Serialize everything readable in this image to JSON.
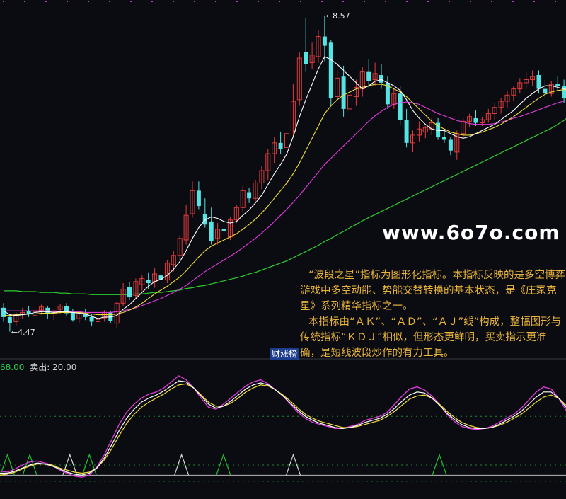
{
  "colors": {
    "background": "#0b0b12",
    "up_candle": "#e03c3c",
    "down_candle": "#54e4e4",
    "ma_white": "#ffffff",
    "ma_yellow": "#f2e03a",
    "ma_magenta": "#e23cdc",
    "ma_green": "#2ecf2e",
    "dotted_grid": "#1f8a2e",
    "buy_triangle": "#22c32e",
    "sell_triangle": "#d9d9d9",
    "text_orange": "#e8b43a"
  },
  "watermark": "www.6o7o.com",
  "description": {
    "line1": "“波段之星”指标为图形化指标。本指标反映的是多空博弈游戏中多空动能、势能交替转换的基本状态，是《庄家克星》系列精华指标之一。",
    "line2": "本指标由“ＡＫ”、“ＡＤ”、“ＡＪ”线”构成，整幅图形与传统指标“ＫＤＪ”相似，但形态更鲜明，买卖指示更准确，是短线波段炒作的有力工具。"
  },
  "tag": "财涨榜",
  "subchart": {
    "buy_text": "68.00",
    "sell_text": "卖出: 20.00"
  },
  "chart_data": [
    {
      "type": "candlestick",
      "annotations": [
        {
          "text": "8.57",
          "kind": "high"
        },
        {
          "text": "4.47",
          "kind": "low"
        }
      ],
      "ylim": [
        4.2,
        8.7
      ],
      "candles": [
        {
          "o": 4.78,
          "h": 4.84,
          "l": 4.6,
          "c": 4.66
        },
        {
          "o": 4.66,
          "h": 4.7,
          "l": 4.47,
          "c": 4.58
        },
        {
          "o": 4.6,
          "h": 4.72,
          "l": 4.55,
          "c": 4.69
        },
        {
          "o": 4.7,
          "h": 4.78,
          "l": 4.64,
          "c": 4.72
        },
        {
          "o": 4.74,
          "h": 4.8,
          "l": 4.66,
          "c": 4.7
        },
        {
          "o": 4.68,
          "h": 4.75,
          "l": 4.6,
          "c": 4.73
        },
        {
          "o": 4.75,
          "h": 4.82,
          "l": 4.69,
          "c": 4.79
        },
        {
          "o": 4.78,
          "h": 4.8,
          "l": 4.64,
          "c": 4.7
        },
        {
          "o": 4.7,
          "h": 4.76,
          "l": 4.62,
          "c": 4.74
        },
        {
          "o": 4.76,
          "h": 4.83,
          "l": 4.7,
          "c": 4.8
        },
        {
          "o": 4.8,
          "h": 4.84,
          "l": 4.68,
          "c": 4.71
        },
        {
          "o": 4.72,
          "h": 4.76,
          "l": 4.6,
          "c": 4.62
        },
        {
          "o": 4.64,
          "h": 4.72,
          "l": 4.58,
          "c": 4.7
        },
        {
          "o": 4.7,
          "h": 4.76,
          "l": 4.62,
          "c": 4.66
        },
        {
          "o": 4.66,
          "h": 4.7,
          "l": 4.55,
          "c": 4.6
        },
        {
          "o": 4.6,
          "h": 4.66,
          "l": 4.52,
          "c": 4.63
        },
        {
          "o": 4.65,
          "h": 4.75,
          "l": 4.6,
          "c": 4.72
        },
        {
          "o": 4.72,
          "h": 4.74,
          "l": 4.58,
          "c": 4.61
        },
        {
          "o": 4.58,
          "h": 4.86,
          "l": 4.52,
          "c": 4.84
        },
        {
          "o": 4.84,
          "h": 5.1,
          "l": 4.8,
          "c": 5.02
        },
        {
          "o": 5.05,
          "h": 5.12,
          "l": 4.88,
          "c": 4.92
        },
        {
          "o": 4.94,
          "h": 5.16,
          "l": 4.9,
          "c": 5.12
        },
        {
          "o": 5.08,
          "h": 5.2,
          "l": 5.0,
          "c": 5.16
        },
        {
          "o": 5.14,
          "h": 5.24,
          "l": 5.02,
          "c": 5.1
        },
        {
          "o": 5.12,
          "h": 5.3,
          "l": 5.04,
          "c": 5.22
        },
        {
          "o": 5.2,
          "h": 5.26,
          "l": 5.08,
          "c": 5.14
        },
        {
          "o": 5.14,
          "h": 5.4,
          "l": 5.1,
          "c": 5.36
        },
        {
          "o": 5.34,
          "h": 5.52,
          "l": 5.25,
          "c": 5.46
        },
        {
          "o": 5.46,
          "h": 5.72,
          "l": 5.4,
          "c": 5.68
        },
        {
          "o": 5.66,
          "h": 6.12,
          "l": 5.6,
          "c": 5.98
        },
        {
          "o": 6.0,
          "h": 6.42,
          "l": 5.95,
          "c": 6.3
        },
        {
          "o": 6.3,
          "h": 6.42,
          "l": 6.06,
          "c": 6.1
        },
        {
          "o": 6.0,
          "h": 6.2,
          "l": 5.82,
          "c": 5.86
        },
        {
          "o": 5.9,
          "h": 6.08,
          "l": 5.6,
          "c": 5.65
        },
        {
          "o": 5.68,
          "h": 5.88,
          "l": 5.6,
          "c": 5.8
        },
        {
          "o": 5.8,
          "h": 5.86,
          "l": 5.7,
          "c": 5.78
        },
        {
          "o": 5.7,
          "h": 5.96,
          "l": 5.66,
          "c": 5.92
        },
        {
          "o": 5.92,
          "h": 6.12,
          "l": 5.88,
          "c": 6.08
        },
        {
          "o": 6.08,
          "h": 6.36,
          "l": 6.02,
          "c": 6.3
        },
        {
          "o": 6.28,
          "h": 6.34,
          "l": 6.14,
          "c": 6.2
        },
        {
          "o": 6.2,
          "h": 6.44,
          "l": 6.16,
          "c": 6.4
        },
        {
          "o": 6.4,
          "h": 6.62,
          "l": 6.32,
          "c": 6.56
        },
        {
          "o": 6.56,
          "h": 6.84,
          "l": 6.44,
          "c": 6.78
        },
        {
          "o": 6.78,
          "h": 7.0,
          "l": 6.66,
          "c": 6.92
        },
        {
          "o": 6.92,
          "h": 7.06,
          "l": 6.78,
          "c": 6.84
        },
        {
          "o": 6.86,
          "h": 7.1,
          "l": 6.82,
          "c": 7.04
        },
        {
          "o": 7.06,
          "h": 7.68,
          "l": 7.0,
          "c": 7.46
        },
        {
          "o": 7.48,
          "h": 8.1,
          "l": 7.4,
          "c": 8.02
        },
        {
          "o": 8.1,
          "h": 8.54,
          "l": 7.84,
          "c": 7.94
        },
        {
          "o": 7.96,
          "h": 8.22,
          "l": 7.88,
          "c": 8.06
        },
        {
          "o": 8.04,
          "h": 8.38,
          "l": 7.96,
          "c": 8.3
        },
        {
          "o": 8.3,
          "h": 8.57,
          "l": 7.98,
          "c": 8.18
        },
        {
          "o": 8.22,
          "h": 8.26,
          "l": 7.4,
          "c": 7.5
        },
        {
          "o": 7.52,
          "h": 7.86,
          "l": 7.48,
          "c": 7.76
        },
        {
          "o": 7.78,
          "h": 7.92,
          "l": 7.26,
          "c": 7.36
        },
        {
          "o": 7.36,
          "h": 7.62,
          "l": 7.24,
          "c": 7.54
        },
        {
          "o": 7.52,
          "h": 7.74,
          "l": 7.4,
          "c": 7.64
        },
        {
          "o": 7.62,
          "h": 7.9,
          "l": 7.52,
          "c": 7.84
        },
        {
          "o": 7.84,
          "h": 8.0,
          "l": 7.64,
          "c": 7.72
        },
        {
          "o": 7.74,
          "h": 7.96,
          "l": 7.66,
          "c": 7.82
        },
        {
          "o": 7.8,
          "h": 7.94,
          "l": 7.62,
          "c": 7.7
        },
        {
          "o": 7.7,
          "h": 7.78,
          "l": 7.36,
          "c": 7.42
        },
        {
          "o": 7.42,
          "h": 7.62,
          "l": 7.36,
          "c": 7.56
        },
        {
          "o": 7.56,
          "h": 7.66,
          "l": 7.16,
          "c": 7.22
        },
        {
          "o": 7.22,
          "h": 7.36,
          "l": 6.86,
          "c": 6.92
        },
        {
          "o": 6.92,
          "h": 7.08,
          "l": 6.8,
          "c": 7.02
        },
        {
          "o": 7.02,
          "h": 7.2,
          "l": 6.94,
          "c": 7.1
        },
        {
          "o": 7.06,
          "h": 7.14,
          "l": 6.98,
          "c": 7.12
        },
        {
          "o": 7.1,
          "h": 7.24,
          "l": 7.02,
          "c": 7.18
        },
        {
          "o": 7.18,
          "h": 7.24,
          "l": 6.96,
          "c": 7.0
        },
        {
          "o": 7.0,
          "h": 7.1,
          "l": 6.92,
          "c": 6.96
        },
        {
          "o": 6.96,
          "h": 7.0,
          "l": 6.76,
          "c": 6.82
        },
        {
          "o": 6.8,
          "h": 7.08,
          "l": 6.7,
          "c": 7.04
        },
        {
          "o": 7.04,
          "h": 7.24,
          "l": 6.98,
          "c": 7.2
        },
        {
          "o": 7.2,
          "h": 7.3,
          "l": 7.12,
          "c": 7.26
        },
        {
          "o": 7.24,
          "h": 7.34,
          "l": 7.14,
          "c": 7.18
        },
        {
          "o": 7.18,
          "h": 7.26,
          "l": 7.14,
          "c": 7.22
        },
        {
          "o": 7.22,
          "h": 7.36,
          "l": 7.18,
          "c": 7.3
        },
        {
          "o": 7.3,
          "h": 7.44,
          "l": 7.22,
          "c": 7.38
        },
        {
          "o": 7.38,
          "h": 7.5,
          "l": 7.3,
          "c": 7.46
        },
        {
          "o": 7.46,
          "h": 7.6,
          "l": 7.38,
          "c": 7.54
        },
        {
          "o": 7.54,
          "h": 7.66,
          "l": 7.46,
          "c": 7.62
        },
        {
          "o": 7.62,
          "h": 7.76,
          "l": 7.56,
          "c": 7.7
        },
        {
          "o": 7.7,
          "h": 7.84,
          "l": 7.62,
          "c": 7.74
        },
        {
          "o": 7.74,
          "h": 7.86,
          "l": 7.66,
          "c": 7.78
        },
        {
          "o": 7.8,
          "h": 7.86,
          "l": 7.56,
          "c": 7.62
        },
        {
          "o": 7.62,
          "h": 7.74,
          "l": 7.5,
          "c": 7.56
        },
        {
          "o": 7.56,
          "h": 7.72,
          "l": 7.52,
          "c": 7.68
        },
        {
          "o": 7.68,
          "h": 7.78,
          "l": 7.6,
          "c": 7.66
        },
        {
          "o": 7.66,
          "h": 7.74,
          "l": 7.44,
          "c": 7.5
        }
      ],
      "ma_lines": {
        "white": [
          4.74,
          4.69,
          4.68,
          4.69,
          4.7,
          4.72,
          4.73,
          4.73,
          4.72,
          4.73,
          4.73,
          4.72,
          4.71,
          4.7,
          4.67,
          4.64,
          4.66,
          4.66,
          4.68,
          4.76,
          4.82,
          4.9,
          4.98,
          5.06,
          5.12,
          5.15,
          5.2,
          5.28,
          5.38,
          5.52,
          5.68,
          5.82,
          5.92,
          5.96,
          5.94,
          5.9,
          5.88,
          5.9,
          5.98,
          6.05,
          6.14,
          6.24,
          6.38,
          6.52,
          6.64,
          6.78,
          7.0,
          7.26,
          7.48,
          7.68,
          7.88,
          8.04,
          8.0,
          7.94,
          7.86,
          7.78,
          7.7,
          7.62,
          7.66,
          7.72,
          7.74,
          7.7,
          7.66,
          7.6,
          7.48,
          7.34,
          7.24,
          7.16,
          7.1,
          7.08,
          7.08,
          7.04,
          7.0,
          6.98,
          7.0,
          7.04,
          7.08,
          7.12,
          7.16,
          7.22,
          7.28,
          7.34,
          7.42,
          7.5,
          7.56,
          7.62,
          7.66,
          7.66,
          7.64,
          7.62,
          7.6
        ],
        "yellow": [
          4.68,
          4.68,
          4.69,
          4.69,
          4.7,
          4.7,
          4.71,
          4.71,
          4.71,
          4.72,
          4.72,
          4.72,
          4.72,
          4.71,
          4.7,
          4.69,
          4.69,
          4.69,
          4.7,
          4.72,
          4.75,
          4.79,
          4.84,
          4.9,
          4.96,
          5.01,
          5.06,
          5.12,
          5.18,
          5.26,
          5.35,
          5.44,
          5.52,
          5.58,
          5.62,
          5.66,
          5.7,
          5.74,
          5.8,
          5.86,
          5.93,
          6.01,
          6.1,
          6.2,
          6.3,
          6.4,
          6.52,
          6.66,
          6.82,
          6.98,
          7.14,
          7.3,
          7.4,
          7.48,
          7.54,
          7.58,
          7.62,
          7.64,
          7.66,
          7.68,
          7.68,
          7.66,
          7.62,
          7.58,
          7.52,
          7.44,
          7.36,
          7.28,
          7.2,
          7.14,
          7.1,
          7.06,
          7.04,
          7.02,
          7.02,
          7.04,
          7.06,
          7.09,
          7.12,
          7.16,
          7.21,
          7.26,
          7.32,
          7.38,
          7.44,
          7.5,
          7.55,
          7.58,
          7.6,
          7.61,
          7.62
        ],
        "magenta": [
          4.74,
          4.74,
          4.74,
          4.74,
          4.74,
          4.74,
          4.74,
          4.74,
          4.73,
          4.73,
          4.73,
          4.73,
          4.73,
          4.72,
          4.72,
          4.72,
          4.72,
          4.72,
          4.73,
          4.74,
          4.76,
          4.78,
          4.81,
          4.84,
          4.87,
          4.9,
          4.94,
          4.98,
          5.02,
          5.07,
          5.13,
          5.19,
          5.25,
          5.3,
          5.35,
          5.4,
          5.45,
          5.5,
          5.56,
          5.62,
          5.68,
          5.75,
          5.82,
          5.9,
          5.98,
          6.06,
          6.15,
          6.24,
          6.34,
          6.44,
          6.54,
          6.64,
          6.72,
          6.8,
          6.88,
          6.96,
          7.04,
          7.12,
          7.2,
          7.27,
          7.33,
          7.38,
          7.42,
          7.44,
          7.45,
          7.44,
          7.42,
          7.38,
          7.34,
          7.3,
          7.27,
          7.24,
          7.21,
          7.19,
          7.17,
          7.16,
          7.16,
          7.16,
          7.17,
          7.19,
          7.21,
          7.24,
          7.26,
          7.29,
          7.32,
          7.35,
          7.38,
          7.41,
          7.44,
          7.46,
          7.48
        ],
        "green": [
          5.0,
          5.0,
          5.0,
          4.99,
          4.99,
          4.99,
          4.98,
          4.98,
          4.98,
          4.97,
          4.97,
          4.96,
          4.96,
          4.96,
          4.95,
          4.95,
          4.95,
          4.95,
          4.95,
          4.95,
          4.95,
          4.96,
          4.96,
          4.97,
          4.98,
          4.98,
          4.99,
          5.0,
          5.01,
          5.03,
          5.04,
          5.06,
          5.07,
          5.09,
          5.11,
          5.13,
          5.15,
          5.17,
          5.19,
          5.22,
          5.24,
          5.27,
          5.3,
          5.33,
          5.36,
          5.39,
          5.43,
          5.47,
          5.51,
          5.55,
          5.59,
          5.64,
          5.68,
          5.73,
          5.77,
          5.82,
          5.86,
          5.91,
          5.95,
          5.99,
          6.03,
          6.07,
          6.11,
          6.15,
          6.19,
          6.23,
          6.27,
          6.31,
          6.35,
          6.39,
          6.43,
          6.47,
          6.51,
          6.55,
          6.59,
          6.63,
          6.67,
          6.71,
          6.75,
          6.79,
          6.83,
          6.87,
          6.91,
          6.95,
          6.99,
          7.03,
          7.07,
          7.11,
          7.16,
          7.21,
          7.28
        ]
      }
    },
    {
      "type": "line",
      "buy_level": 68,
      "sell_level": 20,
      "ylim": [
        -10,
        110
      ],
      "series_values": {
        "magenta": [
          14,
          13,
          16,
          20,
          23,
          24,
          22,
          20,
          15,
          12,
          9,
          8,
          10,
          18,
          30,
          45,
          60,
          72,
          80,
          86,
          90,
          92,
          96,
          102,
          108,
          104,
          96,
          86,
          77,
          75,
          80,
          86,
          92,
          98,
          102,
          104,
          100,
          94,
          88,
          80,
          72,
          66,
          62,
          60,
          58,
          56,
          56,
          58,
          60,
          64,
          66,
          68,
          72,
          80,
          88,
          95,
          97,
          94,
          88,
          80,
          70,
          63,
          58,
          56,
          55,
          56,
          58,
          62,
          66,
          70,
          76,
          84,
          92,
          97,
          95,
          86,
          74
        ],
        "white": [
          12,
          12,
          14,
          17,
          20,
          22,
          21,
          19,
          16,
          13,
          11,
          10,
          12,
          17,
          27,
          40,
          54,
          66,
          75,
          82,
          86,
          89,
          93,
          98,
          103,
          102,
          96,
          88,
          80,
          76,
          78,
          83,
          89,
          95,
          99,
          101,
          99,
          94,
          88,
          81,
          74,
          68,
          64,
          61,
          59,
          57,
          56,
          57,
          59,
          62,
          64,
          66,
          70,
          76,
          83,
          89,
          92,
          91,
          86,
          79,
          71,
          65,
          60,
          57,
          56,
          56,
          57,
          60,
          64,
          68,
          73,
          80,
          87,
          92,
          92,
          86,
          77
        ],
        "yellow": [
          10,
          11,
          13,
          16,
          19,
          21,
          21,
          20,
          17,
          15,
          13,
          12,
          13,
          17,
          25,
          36,
          49,
          61,
          70,
          77,
          82,
          86,
          90,
          95,
          99,
          100,
          96,
          89,
          82,
          78,
          78,
          81,
          86,
          92,
          96,
          99,
          98,
          94,
          89,
          83,
          76,
          70,
          66,
          63,
          61,
          59,
          57,
          57,
          58,
          60,
          62,
          64,
          68,
          73,
          79,
          85,
          88,
          89,
          86,
          80,
          73,
          67,
          62,
          59,
          57,
          56,
          57,
          59,
          62,
          66,
          70,
          76,
          82,
          87,
          89,
          86,
          79
        ]
      },
      "buy_signal_count": 7,
      "sell_signal_count": 3
    }
  ]
}
